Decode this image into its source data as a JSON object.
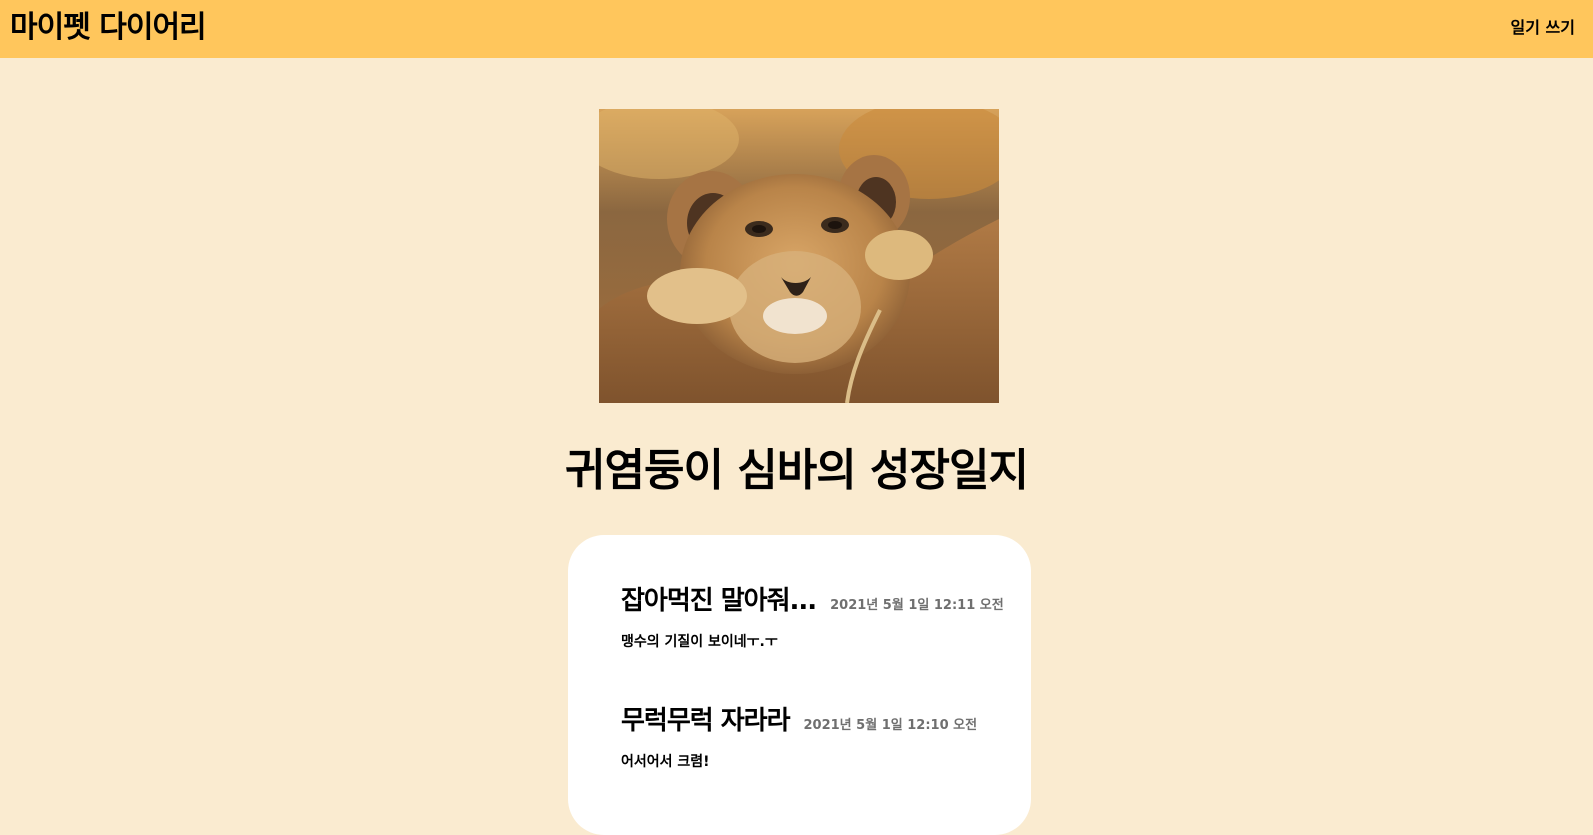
{
  "header": {
    "brand": "마이펫 다이어리",
    "write_link": "일기 쓰기"
  },
  "photo": {
    "subject": "lion-cub-photo"
  },
  "page": {
    "title": "귀염둥이 심바의 성장일지"
  },
  "entries": [
    {
      "title": "잡아먹진 말아줘...",
      "date": "2021년 5월 1일 12:11 오전",
      "body": "맹수의 기질이 보이네ㅜ.ㅜ"
    },
    {
      "title": "무럭무럭 자라라",
      "date": "2021년 5월 1일 12:10 오전",
      "body": "어서어서 크렴!"
    }
  ],
  "colors": {
    "header_bg": "#ffc65c",
    "page_bg": "#faebd0",
    "card_bg": "#ffffff",
    "date_text": "#6f6f6f"
  }
}
